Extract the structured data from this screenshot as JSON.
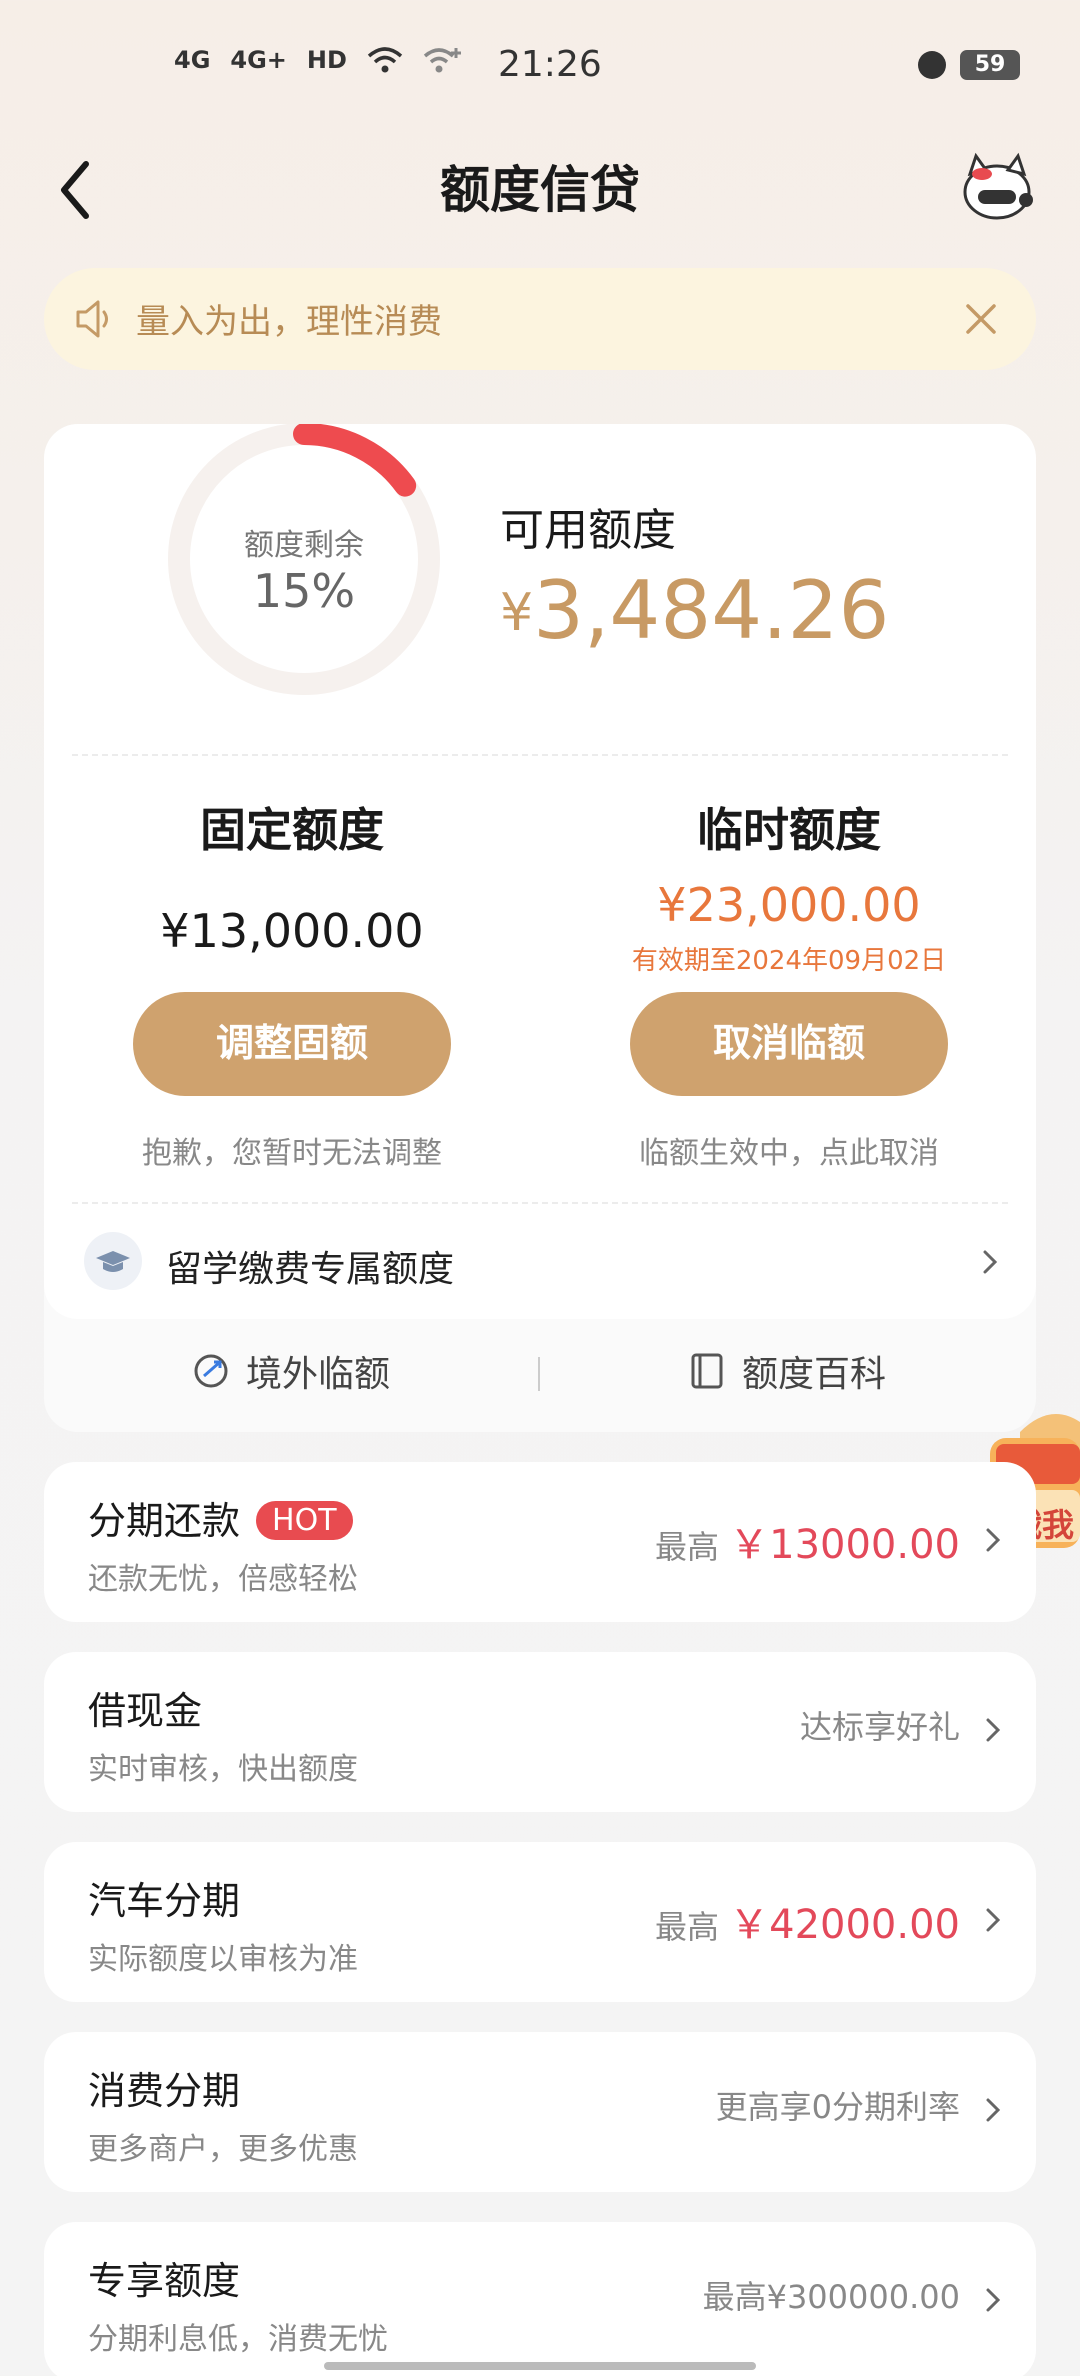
{
  "status_bar": {
    "signals": [
      "4G",
      "4G+",
      "HD",
      "wifi",
      "wifi+"
    ],
    "time": "21:26",
    "battery": "59"
  },
  "header": {
    "title": "额度信贷"
  },
  "notice": {
    "text": "量入为出，理性消费"
  },
  "credit": {
    "ring_label": "额度剩余",
    "ring_percent": "15%",
    "ring_fraction": 0.15,
    "available_label": "可用额度",
    "available_currency": "¥",
    "available_amount": "3,484.26",
    "fixed": {
      "title": "固定额度",
      "amount": "¥13,000.00",
      "button": "调整固额",
      "hint": "抱歉，您暂时无法调整"
    },
    "temporary": {
      "title": "临时额度",
      "amount": "¥23,000.00",
      "expiry": "有效期至2024年09月02日",
      "button": "取消临额",
      "hint": "临额生效中，点此取消"
    },
    "study_abroad": "留学缴费专属额度",
    "bottom_links": {
      "overseas": "境外临额",
      "encyclopedia": "额度百科"
    }
  },
  "promo": {
    "text": "戳我"
  },
  "services": [
    {
      "title": "分期还款",
      "badge": "HOT",
      "subtitle": "还款无忧，倍感轻松",
      "right_prefix": "最高",
      "right_amount": "￥13000.00"
    },
    {
      "title": "借现金",
      "subtitle": "实时审核，快出额度",
      "right_text": "达标享好礼"
    },
    {
      "title": "汽车分期",
      "subtitle": "实际额度以审核为准",
      "right_prefix": "最高",
      "right_amount": "￥42000.00"
    },
    {
      "title": "消费分期",
      "subtitle": "更多商户，更多优惠",
      "right_text": "更高享0分期利率"
    },
    {
      "title": "专享额度",
      "subtitle": "分期利息低，消费无忧",
      "right_text": "最高¥300000.00"
    }
  ],
  "colors": {
    "accent_gold": "#c89a64",
    "button_gold": "#cfa26e",
    "temp_orange": "#e8773c",
    "red": "#e3495a",
    "hot_red": "#e84b50",
    "notice_bg": "#fcf4df"
  }
}
